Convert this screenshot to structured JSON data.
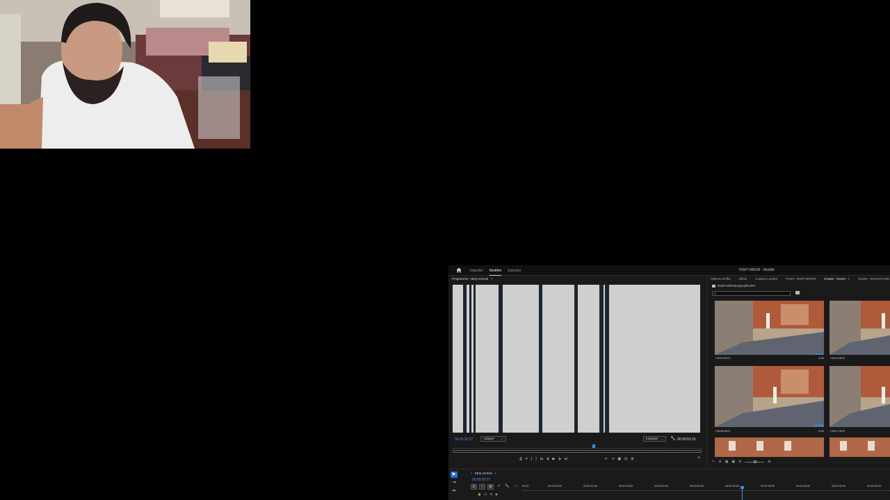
{
  "topbar": {
    "tabs": [
      {
        "label": "Importer",
        "active": false
      },
      {
        "label": "Modifier",
        "active": true
      },
      {
        "label": "Exporter",
        "active": false
      }
    ],
    "document_title": "INSPI MRGM - Modifié"
  },
  "program": {
    "title": "Programme : SEQ vertical",
    "menu_glyph": "≡",
    "timecode_current": "00:00:30:27",
    "fit_dropdown": "Adapter",
    "quality_dropdown": "Intégrale",
    "timecode_duration": "00:00:53:19",
    "transport_left": [
      "⎙",
      "▾",
      "{",
      "}",
      "|◂",
      "◂|",
      "▶",
      "|▸",
      "▸|"
    ],
    "transport_right": [
      "⇤",
      "⇥",
      "▣",
      "⊟",
      "⊞"
    ]
  },
  "bin": {
    "tabs": [
      {
        "label": "Options d'effet",
        "active": false
      },
      {
        "label": "Effets",
        "active": false
      },
      {
        "label": "Couleur Lumetri",
        "active": false
      },
      {
        "label": "Projet : INSPI MRGM",
        "active": false
      },
      {
        "label": "Chutier : RUSH",
        "active": true
      },
      {
        "label": "≡",
        "active": false
      },
      {
        "label": "Chutier : BACKSTAGE",
        "active": false
      }
    ],
    "path": "INSPI MRGM.prproj\\RUSH",
    "clips": [
      {
        "name": "C0003.MP4",
        "duration": "3:36"
      },
      {
        "name": "C0004.MP4",
        "duration": ""
      },
      {
        "name": "C0006.MP4",
        "duration": "0:96"
      },
      {
        "name": "C0007.MP4",
        "duration": ""
      }
    ]
  },
  "timeline": {
    "sequence_title": "SEQ vertical",
    "menu_glyph": "≡",
    "timecode": "00:00:30:27",
    "track_header": [
      "🔒",
      "V1",
      "⊡",
      "◉"
    ],
    "ruler": [
      "00:00",
      "00:00:05:00",
      "00:00:10:00",
      "00:00:15:00",
      "00:00:20:00",
      "00:00:25:00",
      "00:00:30:00",
      "00:00:35:00",
      "00:00:40:00",
      "00:00:45:00",
      "00:00:50:00"
    ]
  },
  "colors": {
    "accent_blue": "#3d8ee8",
    "panel_bg": "#1a1a1a",
    "viewer_bg": "#cfcfcf",
    "bar_dark": "#1c2530"
  }
}
